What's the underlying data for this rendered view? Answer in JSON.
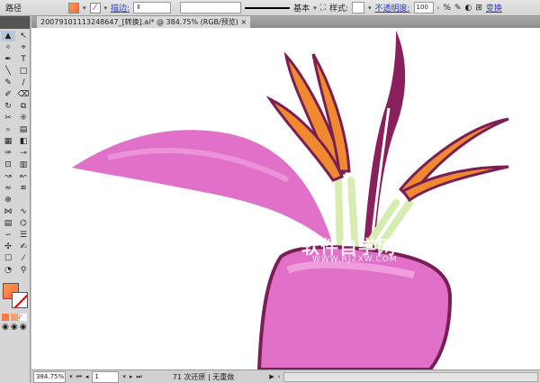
{
  "control_bar": {
    "label": "路径",
    "stroke_label": "描边:",
    "style_label": "样式:",
    "stroke_profile": "基本",
    "opacity_label": "不透明度:",
    "opacity_value": "100",
    "opacity_unit": "%",
    "transform_link": "变换",
    "fill_color": "#ff7a40"
  },
  "document": {
    "tab_title": "20079101113248647_[转换].ai* @ 384.75% (RGB/预览)",
    "close": "×"
  },
  "status_bar": {
    "zoom": "384.75%",
    "page": "1",
    "message": "71 次还原 | 无重做"
  },
  "watermark": {
    "title": "软件自学网",
    "url": "WWW.RJZXW.COM"
  },
  "tools": [
    "▲",
    "↖",
    "✧",
    "⌖",
    "✒",
    "T",
    "╲",
    "□",
    "✎",
    "∕",
    "✐",
    "⌫",
    "↻",
    "⧉",
    "✂",
    "⁜",
    "⌕",
    "▤",
    "▦",
    "◧",
    "✑",
    "⊸",
    "⊡",
    "▥",
    "↝",
    "↜",
    "≈",
    "≋",
    "⊕",
    "",
    "⋈",
    "∿",
    "▤",
    "⌬",
    "∽",
    "☰",
    "✣",
    "✍",
    "☐",
    "⁄",
    "◔",
    "⚲"
  ]
}
